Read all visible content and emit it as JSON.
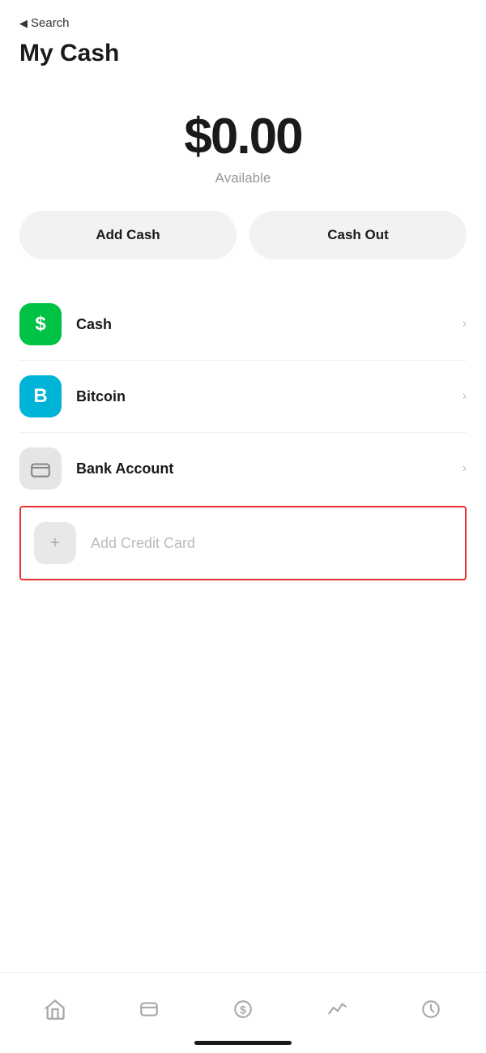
{
  "header": {
    "back_label": "Search",
    "page_title": "My Cash"
  },
  "balance": {
    "amount": "$0.00",
    "label": "Available"
  },
  "actions": {
    "add_cash_label": "Add Cash",
    "cash_out_label": "Cash Out"
  },
  "menu_items": [
    {
      "id": "cash",
      "label": "Cash",
      "icon_type": "green",
      "icon_text": "$",
      "has_chevron": true
    },
    {
      "id": "bitcoin",
      "label": "Bitcoin",
      "icon_type": "blue",
      "icon_text": "B",
      "has_chevron": true
    },
    {
      "id": "bank_account",
      "label": "Bank Account",
      "icon_type": "gray_bank",
      "has_chevron": true
    }
  ],
  "add_credit_card": {
    "label": "Add Credit Card",
    "icon_type": "plus"
  },
  "tab_bar": {
    "items": [
      {
        "id": "home",
        "icon": "home"
      },
      {
        "id": "card",
        "icon": "card"
      },
      {
        "id": "dollar",
        "icon": "dollar"
      },
      {
        "id": "activity",
        "icon": "activity"
      },
      {
        "id": "clock",
        "icon": "clock"
      }
    ]
  },
  "colors": {
    "green": "#00c244",
    "blue": "#00b4d8",
    "gray": "#e5e5e5",
    "highlight_red": "#e83030",
    "text_primary": "#1a1a1a",
    "text_secondary": "#999",
    "text_placeholder": "#bbb",
    "button_bg": "#f2f2f2"
  }
}
